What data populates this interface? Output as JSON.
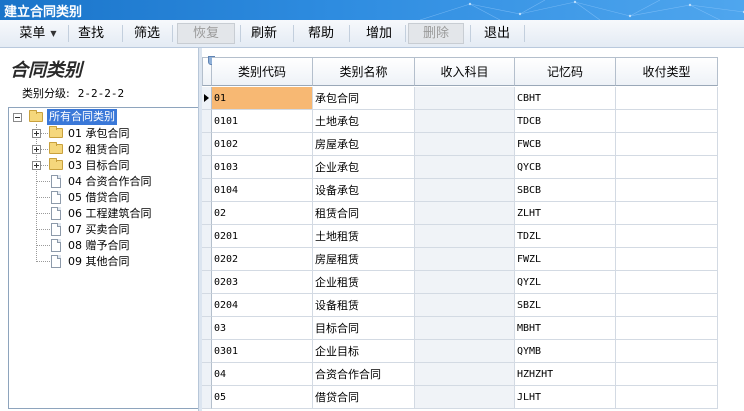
{
  "window": {
    "title": "建立合同类别"
  },
  "toolbar": {
    "menu": "菜单",
    "find": "查找",
    "filter": "筛选",
    "restore": "恢复",
    "refresh": "刷新",
    "help": "帮助",
    "add": "增加",
    "delete": "删除",
    "exit": "退出"
  },
  "left": {
    "title": "合同类别",
    "level_label": "类别分级:",
    "level_value": "2-2-2-2",
    "tree": {
      "root": "所有合同类别",
      "nodes": [
        {
          "label": "01 承包合同",
          "expandable": true
        },
        {
          "label": "02 租赁合同",
          "expandable": true
        },
        {
          "label": "03 目标合同",
          "expandable": true
        },
        {
          "label": "04 合资合作合同",
          "expandable": false
        },
        {
          "label": "05 借贷合同",
          "expandable": false
        },
        {
          "label": "06 工程建筑合同",
          "expandable": false
        },
        {
          "label": "07 买卖合同",
          "expandable": false
        },
        {
          "label": "08 赠予合同",
          "expandable": false
        },
        {
          "label": "09 其他合同",
          "expandable": false
        }
      ]
    }
  },
  "grid": {
    "columns": [
      "类别代码",
      "类别名称",
      "收入科目",
      "记忆码",
      "收付类型"
    ],
    "rows": [
      [
        "01",
        "承包合同",
        "",
        "CBHT",
        ""
      ],
      [
        "0101",
        "土地承包",
        "",
        "TDCB",
        ""
      ],
      [
        "0102",
        "房屋承包",
        "",
        "FWCB",
        ""
      ],
      [
        "0103",
        "企业承包",
        "",
        "QYCB",
        ""
      ],
      [
        "0104",
        "设备承包",
        "",
        "SBCB",
        ""
      ],
      [
        "02",
        "租赁合同",
        "",
        "ZLHT",
        ""
      ],
      [
        "0201",
        "土地租赁",
        "",
        "TDZL",
        ""
      ],
      [
        "0202",
        "房屋租赁",
        "",
        "FWZL",
        ""
      ],
      [
        "0203",
        "企业租赁",
        "",
        "QYZL",
        ""
      ],
      [
        "0204",
        "设备租赁",
        "",
        "SBZL",
        ""
      ],
      [
        "03",
        "目标合同",
        "",
        "MBHT",
        ""
      ],
      [
        "0301",
        "企业目标",
        "",
        "QYMB",
        ""
      ],
      [
        "04",
        "合资合作合同",
        "",
        "HZHZHT",
        ""
      ],
      [
        "05",
        "借贷合同",
        "",
        "JLHT",
        ""
      ]
    ],
    "selected_row": 0
  },
  "colors": {
    "title_bar": "#2e8ce0",
    "selection": "#f7b873",
    "tree_highlight": "#3a78d8"
  }
}
